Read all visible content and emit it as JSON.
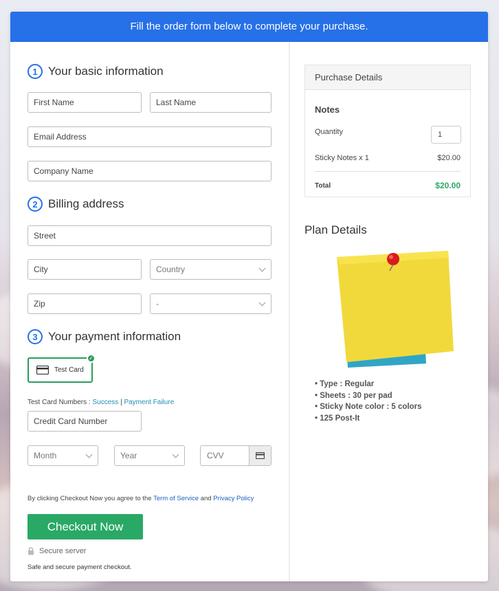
{
  "banner": "Fill the order form below to complete your purchase.",
  "sections": {
    "basic": {
      "num": "1",
      "title": "Your basic information"
    },
    "billing": {
      "num": "2",
      "title": "Billing address"
    },
    "payment": {
      "num": "3",
      "title": "Your payment information"
    }
  },
  "fields": {
    "first_name": "First Name",
    "last_name": "Last Name",
    "email": "Email Address",
    "company": "Company Name",
    "street": "Street",
    "city": "City",
    "country": "Country",
    "zip": "Zip",
    "state": "-",
    "card_number": "Credit Card Number",
    "month": "Month",
    "year": "Year",
    "cvv": "CVV"
  },
  "payment": {
    "method_label": "Test Card",
    "test_numbers_label": "Test Card Numbers :",
    "success": "Success",
    "separator": "|",
    "failure": "Payment Failure"
  },
  "terms": {
    "prefix": "By clicking Checkout Now you agree to the",
    "tos": "Term of Service",
    "and": "and",
    "privacy": "Privacy Policy"
  },
  "checkout_label": "Checkout Now",
  "secure_label": "Secure server",
  "safe_label": "Safe and secure payment checkout.",
  "purchase": {
    "header": "Purchase Details",
    "product": "Notes",
    "quantity_label": "Quantity",
    "quantity_value": "1",
    "line_item": "Sticky Notes x 1",
    "line_price": "$20.00",
    "total_label": "Total",
    "total_value": "$20.00"
  },
  "plan": {
    "title": "Plan Details",
    "features": [
      "Type : Regular",
      "Sheets : 30 per pad",
      "Sticky Note color : 5 colors",
      "125 Post-It"
    ]
  },
  "colors": {
    "primary": "#2670e8",
    "success": "#2aa866",
    "total": "#2aa866"
  }
}
